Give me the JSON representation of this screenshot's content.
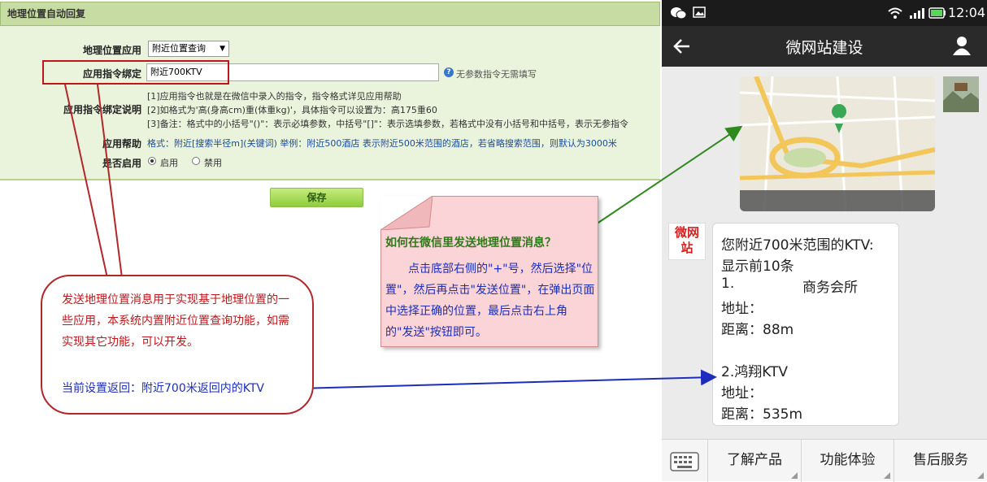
{
  "admin": {
    "header_title": "地理位置自动回复",
    "app_label": "地理位置应用",
    "app_select_value": "附近位置查询",
    "cmd_label": "应用指令绑定",
    "cmd_value": "附近700KTV",
    "cmd_hint": "无参数指令无需填写",
    "desc_label": "应用指令绑定说明",
    "desc_lines": [
      "[1]应用指令也就是在微信中录入的指令，指令格式详见应用帮助",
      "[2]如格式为'高(身高cm)重(体重kg)'，具体指令可以设置为：高175重60",
      "[3]备注：格式中的小括号\"()\"：表示必填参数，中括号\"[]\"：表示选填参数，若格式中没有小括号和中括号，表示无参指令"
    ],
    "help_label": "应用帮助",
    "help_text": "格式：附近[搜索半径m](关键词) 举例：附近500酒店 表示附近500米范围的酒店，若省略搜索范围，则默认为3000米",
    "enable_label": "是否启用",
    "enable_on": "启用",
    "enable_off": "禁用",
    "save_label": "保存"
  },
  "callout_red": {
    "text": "发送地理位置消息用于实现基于地理位置的一些应用，本系统内置附近位置查询功能，如需实现其它功能，可以开发。",
    "current": "当前设置返回：附近700米返回内的KTV"
  },
  "note": {
    "title": "如何在微信里发送地理位置消息？",
    "body": "点击底部右侧的\"+\"号，然后选择\"位置\"，然后再点击\"发送位置\"，在弹出页面中选择正确的位置，最后点击右上角的\"发送\"按钮即可。"
  },
  "phone": {
    "time": "12:04",
    "title": "微网站建设",
    "avatar_text": "微网站",
    "reply_lines": [
      "您附近700米范围的KTV:",
      "显示前10条",
      "1.",
      "商务会所",
      "地址：",
      "距离：88m",
      "2.鸿翔KTV",
      "地址：",
      "距离：535m"
    ],
    "menu": [
      "了解产品",
      "功能体验",
      "售后服务"
    ]
  },
  "colors": {
    "accent_red": "#c0151b",
    "accent_blue": "#1d2dbb",
    "accent_green": "#2f7a18",
    "panel_green": "#eaf3dc"
  }
}
